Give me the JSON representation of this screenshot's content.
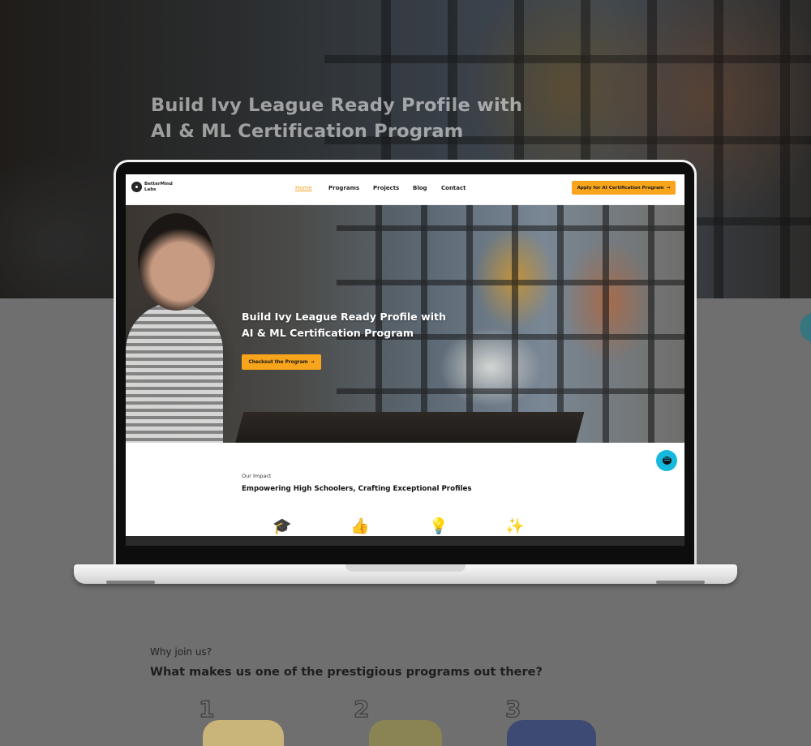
{
  "background_page": {
    "hero_title_line1": "Build Ivy League Ready Profile with",
    "hero_title_line2": "AI & ML Certification Program",
    "why_label": "Why join us?",
    "why_title": "What makes us one of the prestigious programs out there?",
    "steps": [
      "1",
      "2",
      "3"
    ]
  },
  "site": {
    "logo": {
      "line1": "BetterMind",
      "line2": "Labs",
      "icon": "gear-logo-icon"
    },
    "nav": {
      "items": [
        {
          "label": "Home",
          "active": true
        },
        {
          "label": "Programs",
          "active": false
        },
        {
          "label": "Projects",
          "active": false
        },
        {
          "label": "Blog",
          "active": false
        },
        {
          "label": "Contact",
          "active": false
        }
      ],
      "cta_label": "Apply for AI Certification Program",
      "cta_icon": "arrow-right-icon"
    },
    "hero": {
      "title_line1": "Build Ivy League Ready Profile with",
      "title_line2": "AI & ML Certification Program",
      "button_label": "Checkout the Program",
      "button_icon": "arrow-right-icon"
    },
    "impact": {
      "label": "Our Impact",
      "title": "Empowering High Schoolers, Crafting Exceptional Profiles",
      "icons": [
        "graduate-icon",
        "thumbs-up-stars-icon",
        "lightbulb-gear-icon",
        "handshake-sparkles-icon"
      ]
    },
    "chat_icon": "chat-bubble-icon"
  },
  "colors": {
    "accent": "#f8a51c",
    "active_nav": "#f5a623",
    "chat": "#16b9de"
  }
}
